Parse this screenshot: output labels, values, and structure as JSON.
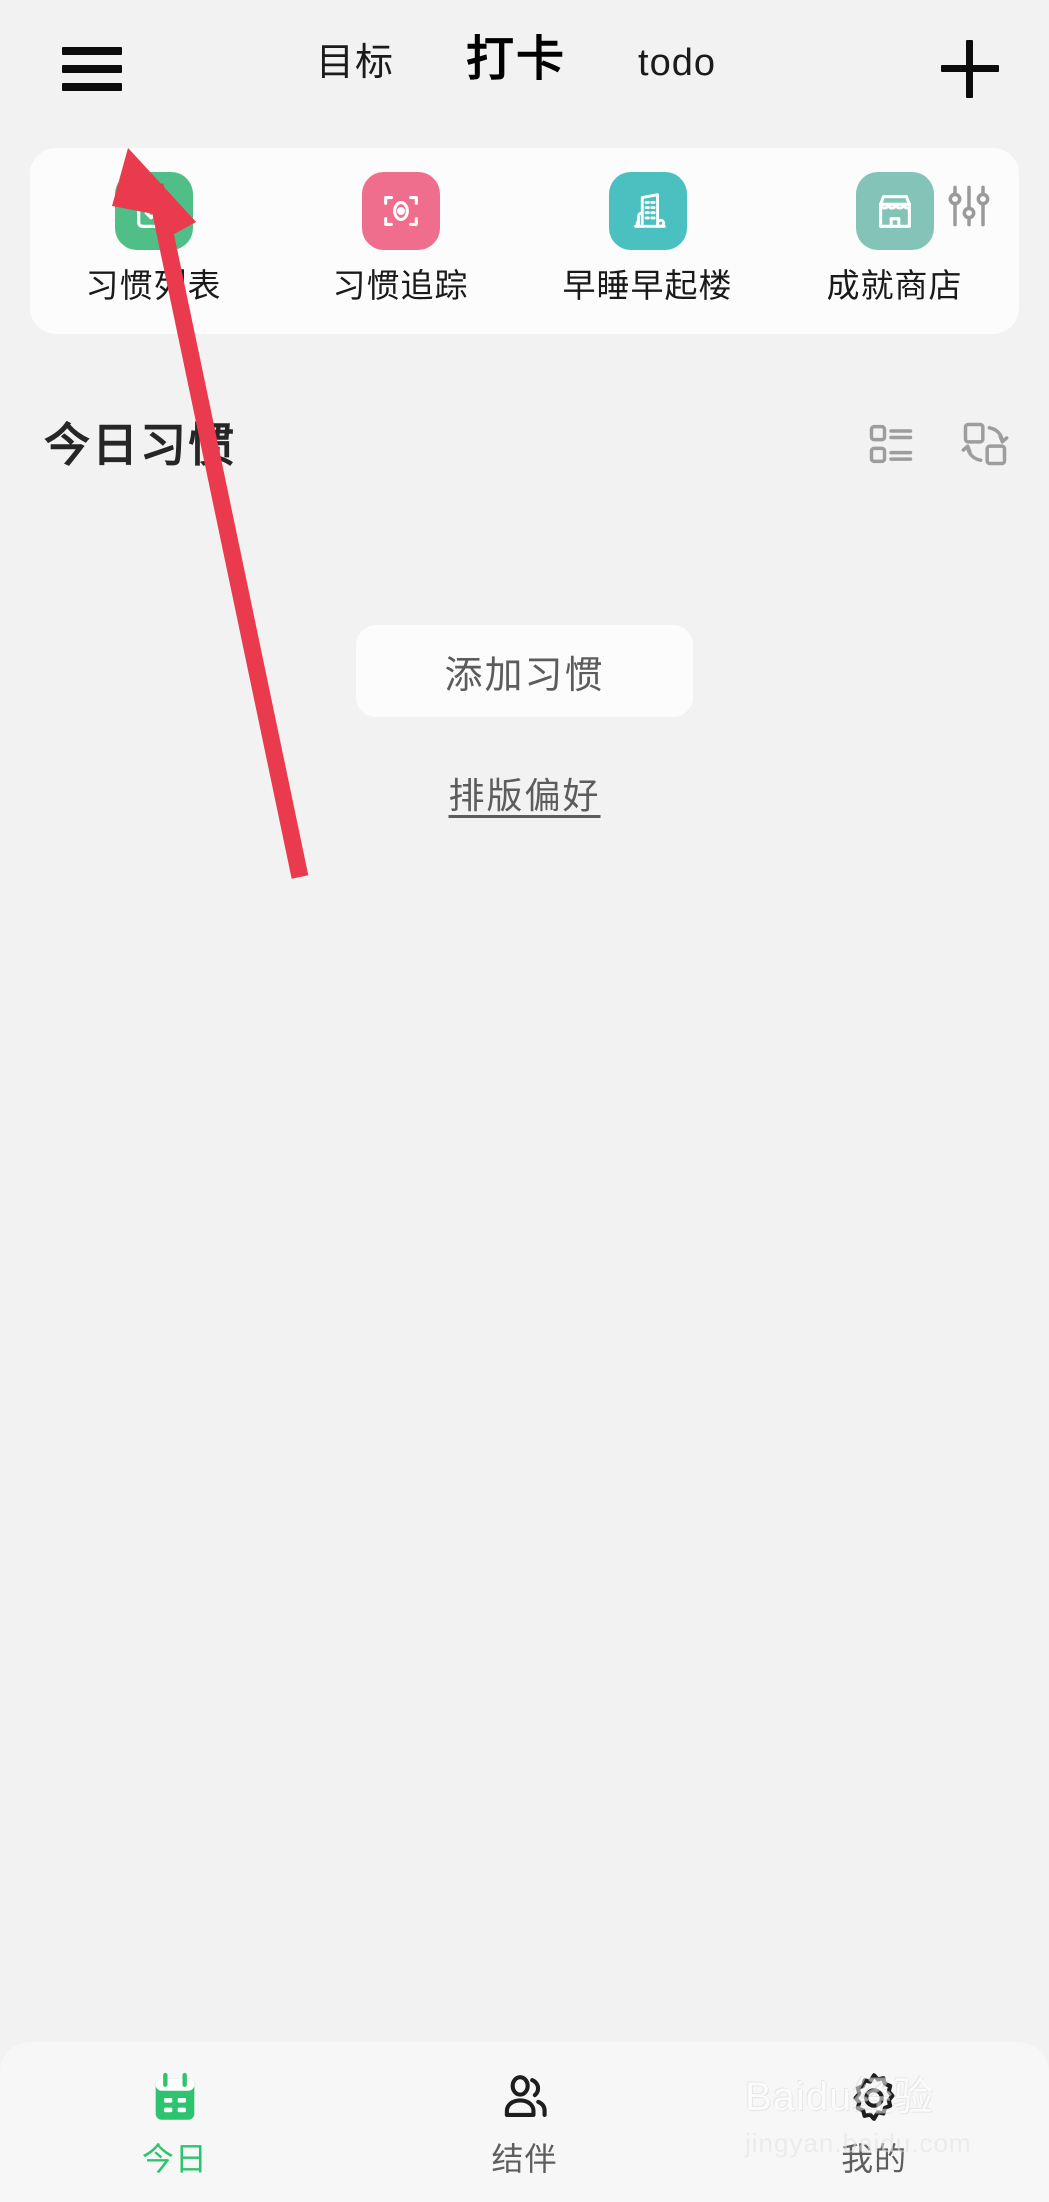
{
  "app": {
    "background": "#f2f2f2",
    "accent_green": "#2ec46f"
  },
  "topbar": {
    "menu_icon": "hamburger-menu-icon",
    "add_icon": "plus-icon",
    "tabs": [
      {
        "label": "目标",
        "active": false
      },
      {
        "label": "打卡",
        "active": true
      },
      {
        "label": "todo",
        "active": false
      }
    ]
  },
  "quick_actions": {
    "settings_icon": "sliders-icon",
    "items": [
      {
        "label": "习惯列表",
        "icon": "checklist-icon",
        "color": "#4fbf87"
      },
      {
        "label": "习惯追踪",
        "icon": "target-focus-icon",
        "color": "#ef6e8e"
      },
      {
        "label": "早睡早起楼",
        "icon": "building-icon",
        "color": "#4bc0c0"
      },
      {
        "label": "成就商店",
        "icon": "store-icon",
        "color": "#84c4b8"
      }
    ]
  },
  "section": {
    "title": "今日习惯",
    "view_toggles": [
      {
        "icon": "list-view-icon",
        "active": false
      },
      {
        "icon": "swap-view-icon",
        "active": false
      }
    ]
  },
  "empty_state": {
    "add_button_label": "添加习惯",
    "layout_pref_label": "排版偏好"
  },
  "bottom_nav": {
    "items": [
      {
        "label": "今日",
        "icon": "calendar-icon",
        "active": true
      },
      {
        "label": "结伴",
        "icon": "people-icon",
        "active": false
      },
      {
        "label": "我的",
        "icon": "gear-icon",
        "active": false
      }
    ]
  },
  "annotation": {
    "arrow_color": "#ea3b4e",
    "points_to": "hamburger-menu-icon"
  },
  "watermark": {
    "main": "Baidu经验",
    "sub": "jingyan.baidu.com"
  }
}
